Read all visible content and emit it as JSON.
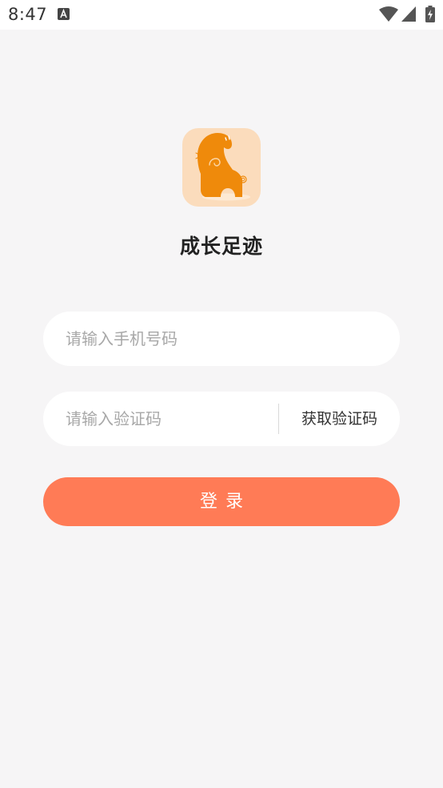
{
  "status_bar": {
    "time": "8:47",
    "notification_icon": "app-notification-icon",
    "wifi_icon": "wifi-icon",
    "signal_icon": "cell-signal-icon",
    "battery_icon": "battery-charging-icon"
  },
  "app": {
    "logo_icon": "elephant-logo-icon",
    "title": "成长足迹"
  },
  "login_form": {
    "phone_placeholder": "请输入手机号码",
    "phone_value": "",
    "code_placeholder": "请输入验证码",
    "code_value": "",
    "get_code_label": "获取验证码",
    "login_label": "登录"
  },
  "colors": {
    "background": "#f6f5f6",
    "accent": "#ff7b56",
    "logo_background": "#fbdcbc",
    "logo_elephant": "#ef8a0b"
  }
}
